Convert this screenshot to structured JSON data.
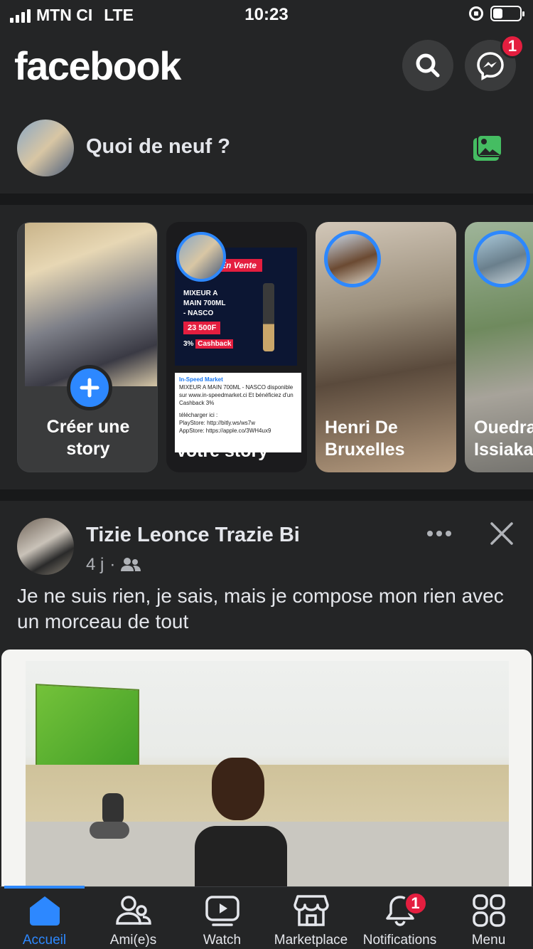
{
  "status_bar": {
    "carrier": "MTN CI",
    "network": "LTE",
    "time": "10:23",
    "battery_level": 0.35
  },
  "header": {
    "logo": "facebook",
    "messenger_badge": "1"
  },
  "composer": {
    "prompt": "Quoi de neuf ?"
  },
  "stories": {
    "create": {
      "line1": "Créer une",
      "line2": "story"
    },
    "items": [
      {
        "line1": "",
        "line2": "Votre story"
      },
      {
        "line1": "Henri De",
        "line2": "Bruxelles"
      },
      {
        "line1": "Ouedra",
        "line2": "Issiaka"
      }
    ],
    "ad": {
      "banner": "En Vente",
      "line1": "MIXEUR A",
      "line2": "MAIN 700ML",
      "line3": "- NASCO",
      "price": "23 500F",
      "cashback_pct": "3%",
      "cashback": "Cashback",
      "source": "In-Speed Market",
      "desc": "MIXEUR A MAIN 700ML - NASCO disponible sur www.in-speedmarket.ci Et bénéficiez d'un Cashback 3%",
      "dl": "télécharger ici :",
      "play": "PlayStore: http://bitly.ws/ws7w",
      "app": "AppStore: https://apple.co/3WH4ux9"
    }
  },
  "post": {
    "author": "Tizie Leonce Trazie Bi",
    "time": "4 j",
    "text": "Je ne suis rien, je sais, mais je compose mon rien avec un morceau de tout"
  },
  "tabbar": {
    "tabs": [
      {
        "label": "Accueil",
        "icon": "home-icon"
      },
      {
        "label": "Ami(e)s",
        "icon": "friends-icon"
      },
      {
        "label": "Watch",
        "icon": "watch-icon"
      },
      {
        "label": "Marketplace",
        "icon": "marketplace-icon"
      },
      {
        "label": "Notifications",
        "icon": "bell-icon"
      },
      {
        "label": "Menu",
        "icon": "menu-icon"
      }
    ],
    "notifications_badge": "1"
  },
  "colors": {
    "accent": "#2d88ff",
    "badge": "#e41e3f",
    "background": "#242526",
    "separator": "#18191a"
  }
}
